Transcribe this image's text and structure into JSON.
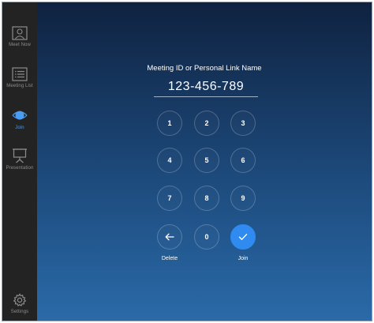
{
  "sidebar": {
    "items": [
      {
        "label": "Meet Now",
        "icon": "meet-now-icon"
      },
      {
        "label": "Meeting List",
        "icon": "meeting-list-icon"
      },
      {
        "label": "Join",
        "icon": "join-icon",
        "active": true
      },
      {
        "label": "Presentation",
        "icon": "presentation-icon"
      }
    ],
    "settings": {
      "label": "Settings",
      "icon": "gear-icon"
    }
  },
  "main": {
    "title": "Meeting ID or Personal Link Name",
    "meeting_id": "123-456-789"
  },
  "keypad": {
    "keys": [
      "1",
      "2",
      "3",
      "4",
      "5",
      "6",
      "7",
      "8",
      "9",
      "0"
    ],
    "delete_label": "Delete",
    "join_label": "Join"
  },
  "colors": {
    "accent": "#2f8bef",
    "sidebar_bg": "#232323",
    "gradient_top": "#0f2240",
    "gradient_bottom": "#2a6aa8"
  }
}
